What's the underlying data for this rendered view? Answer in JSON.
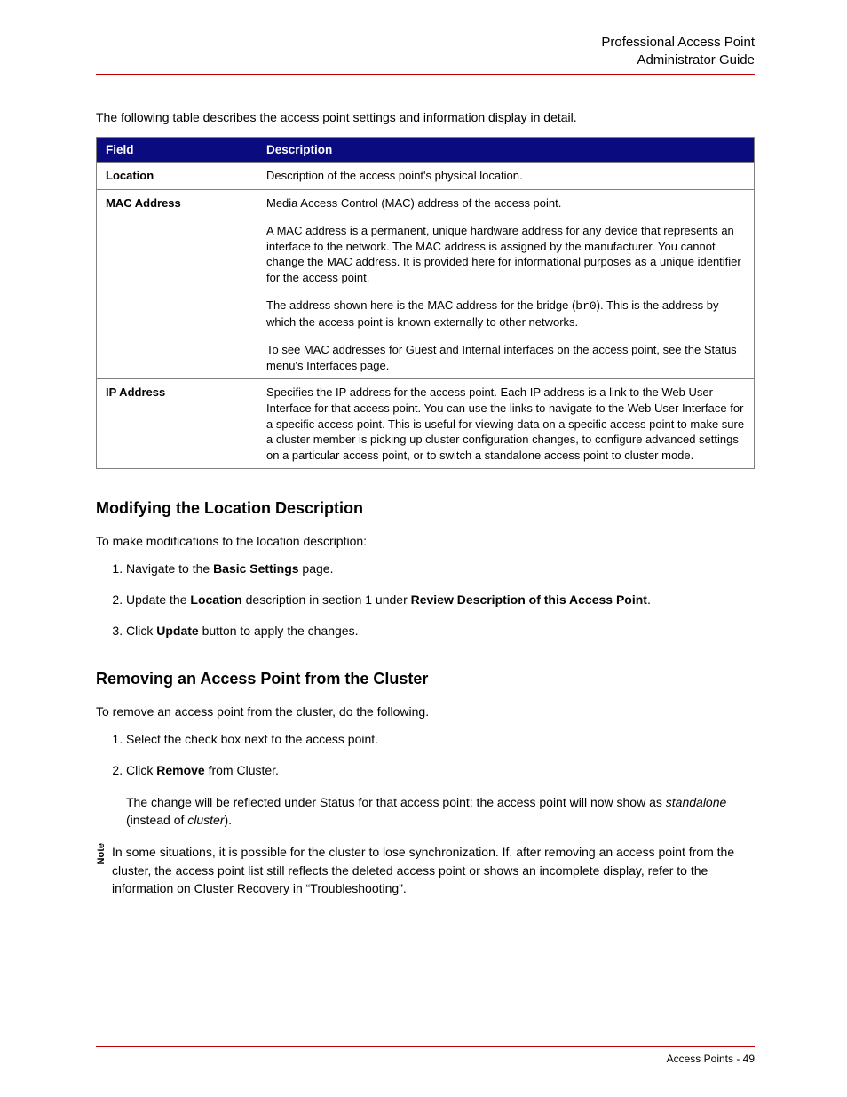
{
  "header": {
    "line1": "Professional Access Point",
    "line2": "Administrator Guide"
  },
  "intro": "The following table describes the access point settings and information display in detail.",
  "table": {
    "head_field": "Field",
    "head_desc": "Description",
    "rows": {
      "location": {
        "field": "Location",
        "desc": "Description of the access point's physical location."
      },
      "mac": {
        "field": "MAC Address",
        "p1": "Media Access Control (MAC) address of the access point.",
        "p2": "A MAC address is a permanent, unique hardware address for any device that represents an interface to the network. The MAC address is assigned by the manufacturer. You cannot change the MAC address. It is provided here for informational purposes as a unique identifier for the access point.",
        "p3a": "The address shown here is the MAC address for the bridge (",
        "p3code": "br0",
        "p3b": "). This is the address by which the access point is known externally to other networks.",
        "p4": "To see MAC addresses for Guest and Internal interfaces on the access point, see the Status menu's Interfaces page."
      },
      "ip": {
        "field": "IP Address",
        "desc": "Specifies the IP address for the access point. Each IP address is a link to the Web User Interface for that access point. You can use the links to navigate to the Web User Interface for a specific access point. This is useful for viewing data on a specific access point to make sure a cluster member is picking up cluster configuration changes, to configure advanced settings on a particular access point, or to switch a standalone access point to cluster mode."
      }
    }
  },
  "section1": {
    "heading": "Modifying the Location Description",
    "intro": "To make modifications to the location description:",
    "step1a": "Navigate to the ",
    "step1b": "Basic Settings",
    "step1c": " page.",
    "step2a": "Update the ",
    "step2b": "Location",
    "step2c": " description in section 1 under ",
    "step2d": "Review Description of this Access Point",
    "step2e": ".",
    "step3a": "Click ",
    "step3b": "Update",
    "step3c": " button to apply the changes."
  },
  "section2": {
    "heading": "Removing an Access Point from the Cluster",
    "intro": "To remove an access point from the cluster, do the following.",
    "step1": "Select the check box next to the access point.",
    "step2a": "Click ",
    "step2b": "Remove",
    "step2c": " from Cluster.",
    "follow_a": "The change will be reflected under Status for that access point; the access point will now show as ",
    "follow_b": "standalone",
    "follow_c": " (instead of ",
    "follow_d": "cluster",
    "follow_e": ")."
  },
  "note": {
    "label": "Note",
    "text": "In some situations, it is possible for the cluster to lose synchronization. If, after removing an access point from the cluster, the access point list still reflects the deleted access point or shows an incomplete display, refer to the information on Cluster Recovery in “Troubleshooting”."
  },
  "footer": {
    "text": "Access Points - 49"
  }
}
